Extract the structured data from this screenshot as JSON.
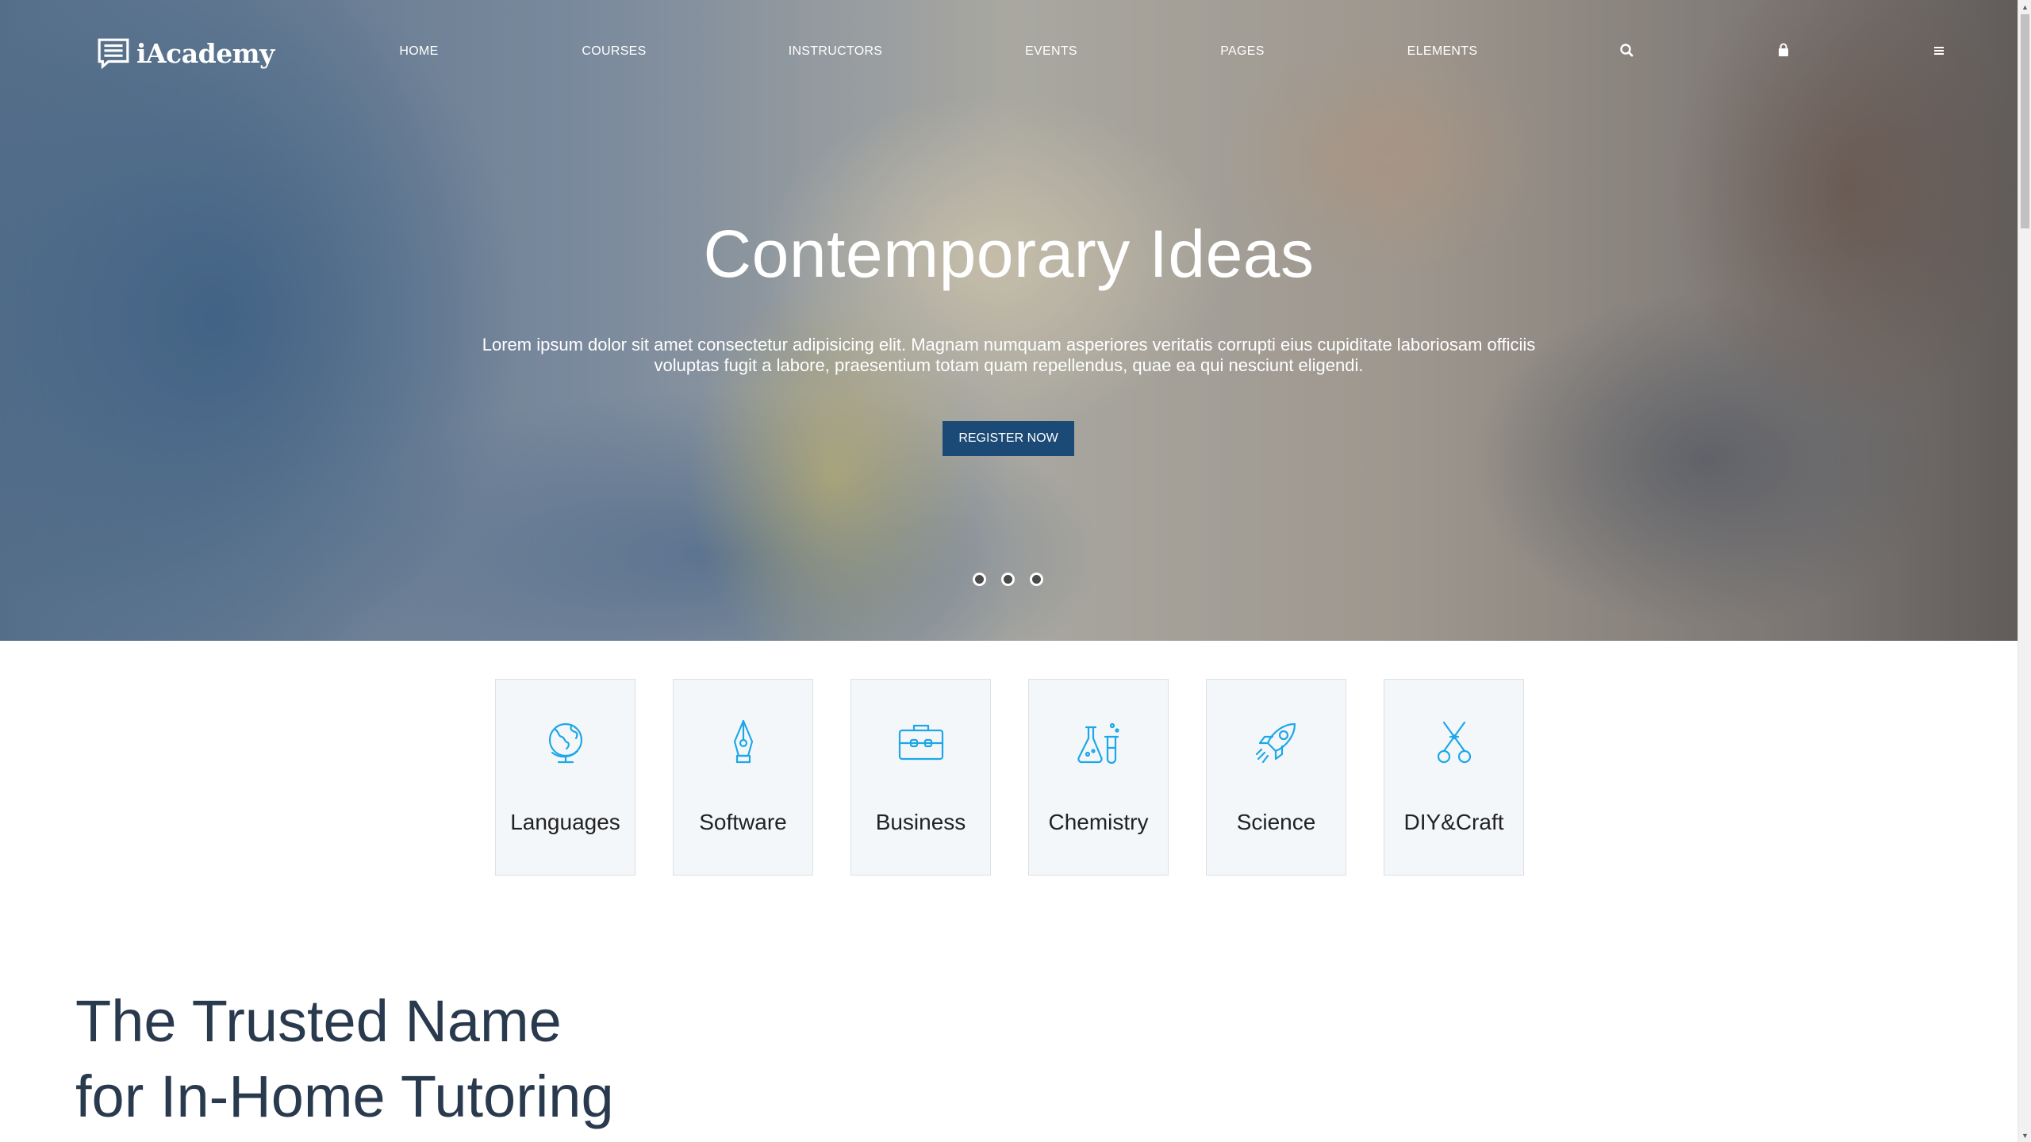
{
  "brand": {
    "name": "iAcademy"
  },
  "nav": {
    "items": [
      {
        "label": "HOME"
      },
      {
        "label": "COURSES"
      },
      {
        "label": "INSTRUCTORS"
      },
      {
        "label": "EVENTS"
      },
      {
        "label": "PAGES"
      },
      {
        "label": "ELEMENTS"
      }
    ],
    "icons": [
      "search-icon",
      "shopping-bag-icon",
      "menu-icon"
    ]
  },
  "hero": {
    "title": "Contemporary Ideas",
    "text": "Lorem ipsum dolor sit amet consectetur adipisicing elit. Magnam numquam asperiores veritatis corrupti eius cupiditate laboriosam officiis voluptas fugit a labore, praesentium totam quam repellendus, quae ea qui nesciunt eligendi.",
    "cta_label": "REGISTER NOW",
    "slides": 3,
    "cta_color": "#1a4a75"
  },
  "categories": [
    {
      "label": "Languages",
      "icon": "globe-icon"
    },
    {
      "label": "Software",
      "icon": "pen-nib-icon"
    },
    {
      "label": "Business",
      "icon": "briefcase-icon"
    },
    {
      "label": "Chemistry",
      "icon": "lab-flask-icon"
    },
    {
      "label": "Science",
      "icon": "rocket-icon"
    },
    {
      "label": "DIY&Craft",
      "icon": "scissors-icon"
    }
  ],
  "section": {
    "heading_line1": "The Trusted Name",
    "heading_line2": "for In-Home Tutoring"
  },
  "colors": {
    "accent_icon": "#1da7e8",
    "heading_text": "#2a3a4e",
    "card_bg": "#f4f7fa"
  }
}
